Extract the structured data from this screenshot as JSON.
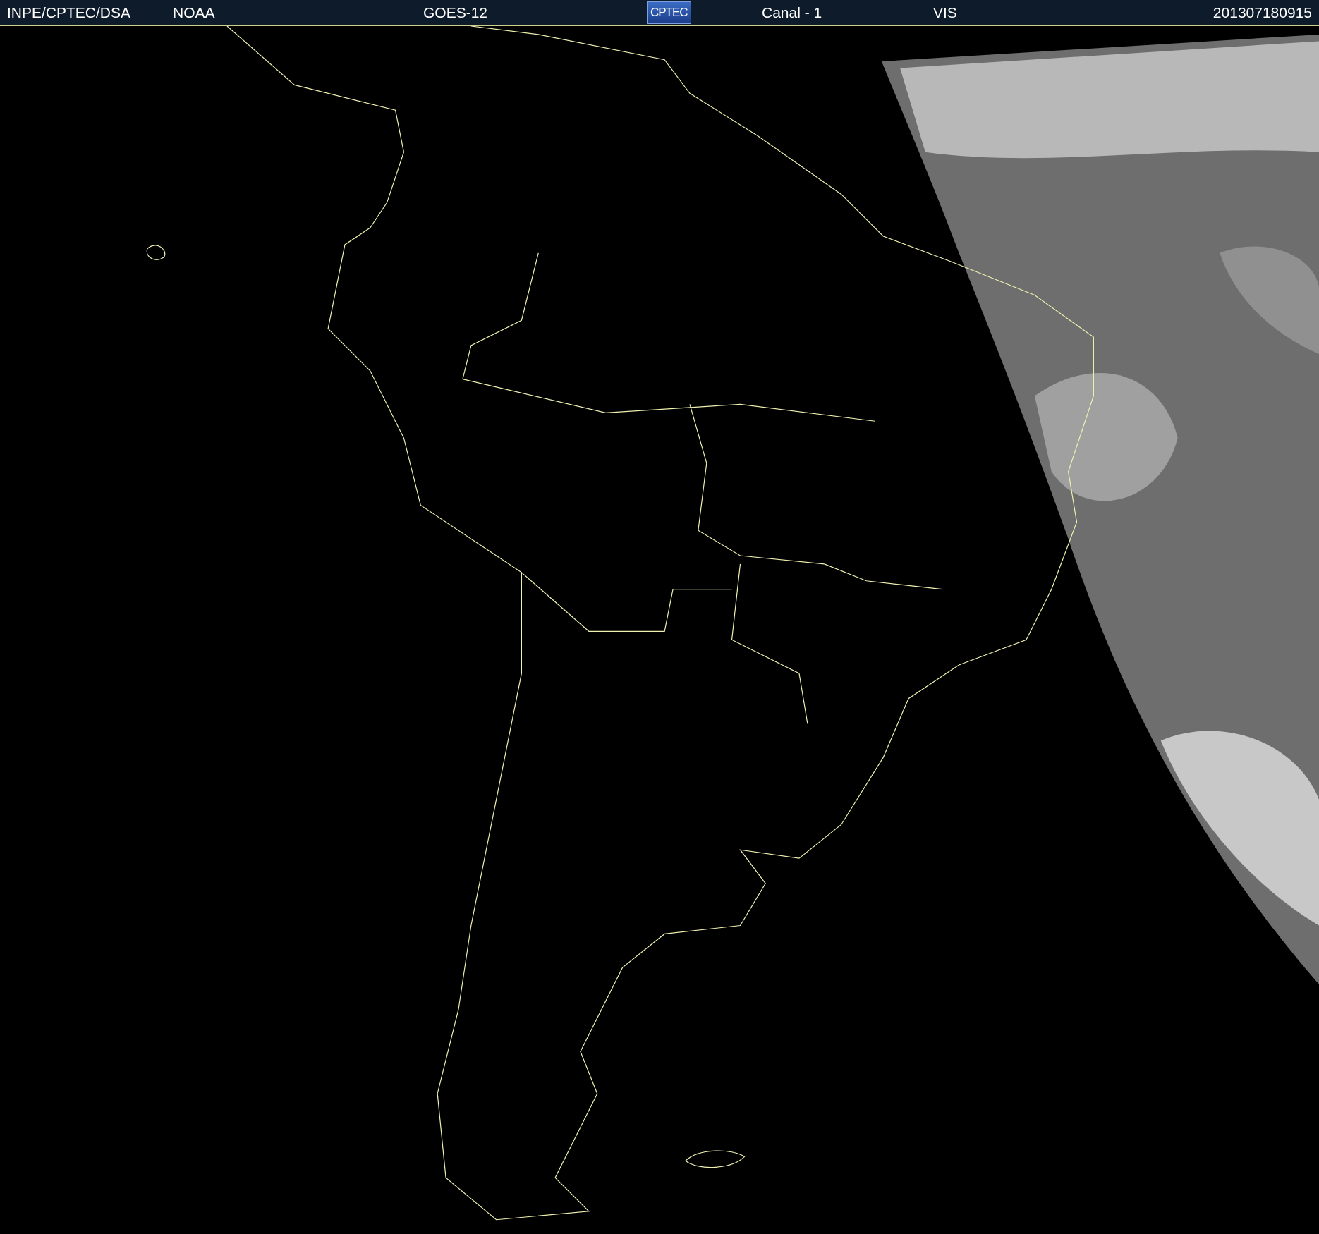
{
  "header": {
    "items": [
      {
        "kind": "label",
        "text": "INPE/CPTEC/DSA"
      },
      {
        "kind": "label",
        "text": "NOAA"
      },
      {
        "kind": "label",
        "text": "GOES-12"
      },
      {
        "kind": "logo",
        "text": "CPTEC"
      },
      {
        "kind": "label",
        "text": "Canal - 1"
      },
      {
        "kind": "label",
        "text": "VIS"
      },
      {
        "kind": "label",
        "text": "201307180915"
      }
    ]
  }
}
